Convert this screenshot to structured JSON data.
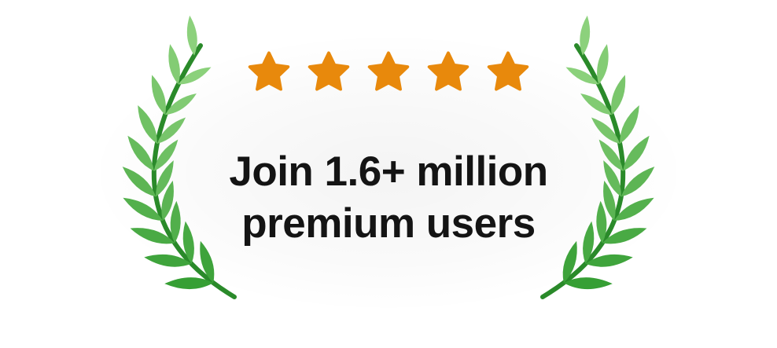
{
  "badge": {
    "line1": "Join 1.6+ million",
    "line2": "premium users",
    "rating": {
      "value": 5,
      "max": 5
    },
    "star_icon": "star-icon",
    "wreath_icon": "laurel-wreath-icon",
    "colors": {
      "star": "#E8890C",
      "leaf_light": "#8FD37E",
      "leaf_dark": "#2E9A2E",
      "stem": "#2A8A2A",
      "text": "#141414",
      "background": "#FFFFFF"
    }
  }
}
